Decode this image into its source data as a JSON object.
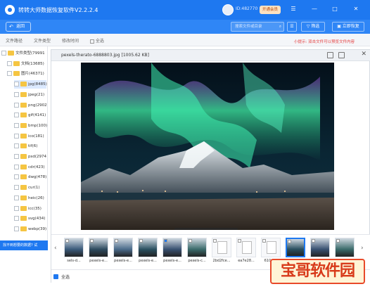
{
  "app": {
    "title": "转转大师数据恢复软件V2.2.2.4",
    "user_id": "ID:482770",
    "vip_label": "开通会员",
    "window_controls": [
      "menu-icon",
      "minimize-icon",
      "maximize-icon",
      "close-icon"
    ]
  },
  "toolbar": {
    "back_label": "返回",
    "search_placeholder": "搜索文件或目录",
    "filter_label": "筛选",
    "restore_label": "立即恢复"
  },
  "tabs": {
    "items": [
      "文件路径",
      "文件类型",
      "修改时间"
    ],
    "select_all": "全选"
  },
  "hint": "小提示: 双击文件可以预览文件内容",
  "tree": [
    {
      "label": "文件类型(79991",
      "level": 0,
      "checked": false
    },
    {
      "label": "文档(13685)",
      "level": 1,
      "checked": false
    },
    {
      "label": "图片(46371)",
      "level": 1,
      "checked": false
    },
    {
      "label": "jpg(8485)",
      "level": 2,
      "checked": false,
      "selected": true
    },
    {
      "label": "jpeg(21)",
      "level": 2,
      "checked": false
    },
    {
      "label": "png(2902",
      "level": 2,
      "checked": false
    },
    {
      "label": "gif(4141)",
      "level": 2,
      "checked": false
    },
    {
      "label": "bmp(100)",
      "level": 2,
      "checked": false
    },
    {
      "label": "ico(181)",
      "level": 2,
      "checked": false
    },
    {
      "label": "tif(6)",
      "level": 2,
      "checked": false
    },
    {
      "label": "psd(2974",
      "level": 2,
      "checked": false
    },
    {
      "label": "cdr(423)",
      "level": 2,
      "checked": false
    },
    {
      "label": "dwg(478)",
      "level": 2,
      "checked": false
    },
    {
      "label": "cur(1)",
      "level": 2,
      "checked": false
    },
    {
      "label": "heic(26)",
      "level": 2,
      "checked": false
    },
    {
      "label": "icc(35)",
      "level": 2,
      "checked": false
    },
    {
      "label": "svg(434)",
      "level": 2,
      "checked": false
    },
    {
      "label": "webp(39)",
      "level": 2,
      "checked": false
    }
  ],
  "feedback": "找不到想要的数据? 试",
  "preview": {
    "filename": "pexels-therato-6888803.jpg [1005.62 KB]",
    "controls": [
      "fullscreen-icon",
      "zoom-in-icon",
      "zoom-out-icon",
      "rotate-icon",
      "copy-icon"
    ]
  },
  "thumbnails": [
    {
      "label": "sels-d...",
      "kind": "photo",
      "checked": false
    },
    {
      "label": "pexels-e...",
      "kind": "photo",
      "checked": false
    },
    {
      "label": "pexels-e...",
      "kind": "photo",
      "checked": false
    },
    {
      "label": "pexels-e...",
      "kind": "photo",
      "checked": false
    },
    {
      "label": "pexels-e...",
      "kind": "photo",
      "checked": true
    },
    {
      "label": "pexels-c...",
      "kind": "photo",
      "checked": false
    },
    {
      "label": "2bd2fce...",
      "kind": "doc",
      "checked": false
    },
    {
      "label": "ea7e28...",
      "kind": "doc",
      "checked": false
    },
    {
      "label": "610af...",
      "kind": "doc",
      "checked": false
    },
    {
      "label": "pexels-t...",
      "kind": "photo",
      "checked": false,
      "selected": true
    },
    {
      "label": "pexels-...",
      "kind": "photo",
      "checked": false
    },
    {
      "label": "pexels-...",
      "kind": "photo",
      "checked": false
    }
  ],
  "bottom": {
    "select_all": "全选"
  },
  "watermark": "宝哥软件园"
}
